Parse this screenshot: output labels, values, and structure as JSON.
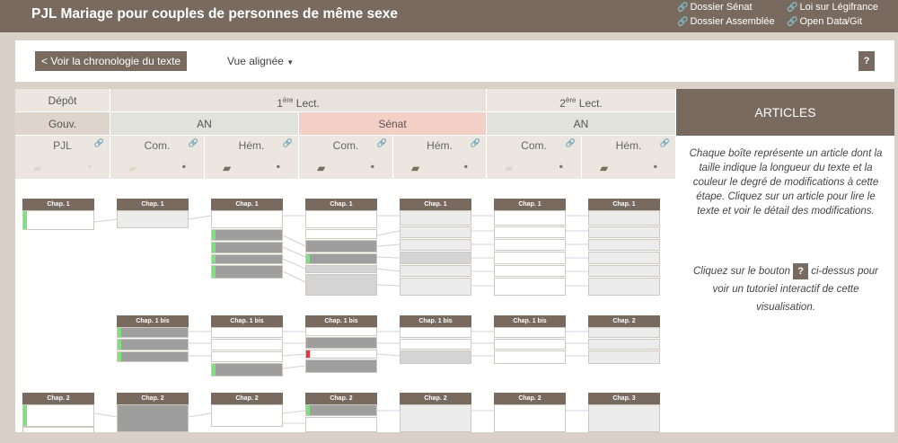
{
  "header": {
    "title": "PJL Mariage pour couples de personnes de même sexe",
    "links": {
      "dossier_senat": "Dossier Sénat",
      "dossier_assemblee": "Dossier Assemblée",
      "loi_legifrance": "Loi sur Légifrance",
      "open_data": "Open Data",
      "git": "/Git"
    }
  },
  "toolbar": {
    "chrono_label": "< Voir la chronologie du texte",
    "view_label": "Vue alignée",
    "help_label": "?"
  },
  "stages": {
    "depot": "Dépôt",
    "lect1_num": "1",
    "lect1_sup": "ère",
    "lect1_rest": " Lect.",
    "lect2_num": "2",
    "lect2_sup": "ère",
    "lect2_rest": " Lect."
  },
  "institutions": {
    "gouv": "Gouv.",
    "an1": "AN",
    "senat": "Sénat",
    "an2": "AN"
  },
  "columns": [
    "PJL",
    "Com.",
    "Hém.",
    "Com.",
    "Hém.",
    "Com.",
    "Hém."
  ],
  "chapters": {
    "c1": "Chap. 1",
    "c1bis": "Chap. 1 bis",
    "c2": "Chap. 2",
    "c3": "Chap. 3"
  },
  "sidebar": {
    "title": "ARTICLES",
    "description": "Chaque boîte représente un article dont la taille indique la longueur du texte et la couleur le degré de modifications à cette étape. Cliquez sur un article pour lire le texte et voir le détail des modifications.",
    "hint_before": "Cliquez sur le bouton",
    "hint_button": "?",
    "hint_after": "ci-dessus pour voir un tutoriel interactif de cette visualisation."
  }
}
